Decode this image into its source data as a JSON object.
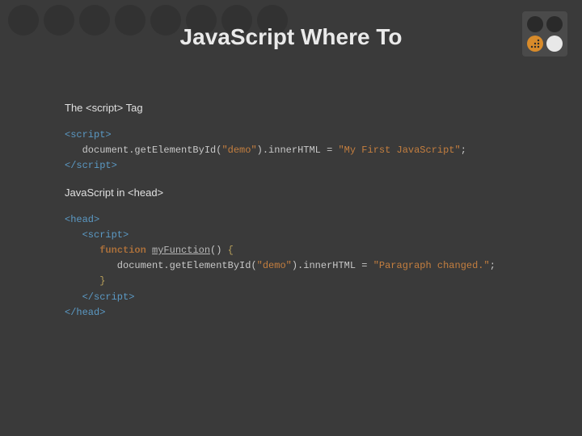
{
  "title": "JavaScript Where To",
  "section1": {
    "label_prefix": "The ",
    "label_tag": "<script>",
    "label_suffix": " Tag",
    "code": {
      "open": "<script>",
      "line_prefix": "   document.getElementById(",
      "str1": "\"demo\"",
      "mid": ").innerHTML = ",
      "str2": "\"My First JavaScript\"",
      "end": ";",
      "close": "</script>"
    }
  },
  "section2": {
    "label_prefix": "JavaScript in ",
    "label_tag": "<head>",
    "code": {
      "head_open": "<head>",
      "script_open": "   <script>",
      "kw": "function",
      "fn": "myFunction",
      "paren": "()",
      "brace_open": " {",
      "line_prefix": "         document.getElementById(",
      "str1": "\"demo\"",
      "mid": ").innerHTML = ",
      "str2": "\"Paragraph changed.\"",
      "end": ";",
      "brace_close": "      }",
      "script_close": "   </script>",
      "head_close": "</head>"
    }
  }
}
